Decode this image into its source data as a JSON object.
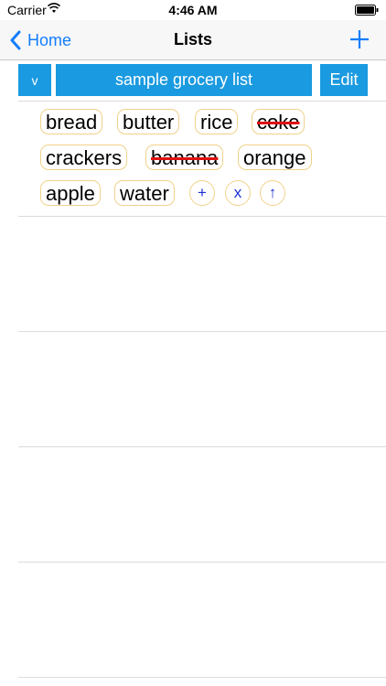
{
  "status_bar": {
    "carrier": "Carrier",
    "time": "4:46 AM"
  },
  "nav": {
    "back_label": "Home",
    "title": "Lists"
  },
  "header": {
    "toggle_label": "v",
    "list_name": "sample grocery list",
    "edit_label": "Edit"
  },
  "items": [
    {
      "label": "bread",
      "crossed": false
    },
    {
      "label": "butter",
      "crossed": false
    },
    {
      "label": "rice",
      "crossed": false
    },
    {
      "label": "coke",
      "crossed": true
    },
    {
      "label": "crackers",
      "crossed": false
    },
    {
      "label": "banana",
      "crossed": true
    },
    {
      "label": "orange",
      "crossed": false
    },
    {
      "label": "apple",
      "crossed": false
    },
    {
      "label": "water",
      "crossed": false
    }
  ],
  "actions": {
    "add_label": "+",
    "remove_label": "x",
    "move_up_label": "↑"
  },
  "colors": {
    "accent": "#1a9ae0",
    "ios_blue": "#147efb",
    "chip_border": "#f0d28a",
    "strike": "#e01010"
  }
}
